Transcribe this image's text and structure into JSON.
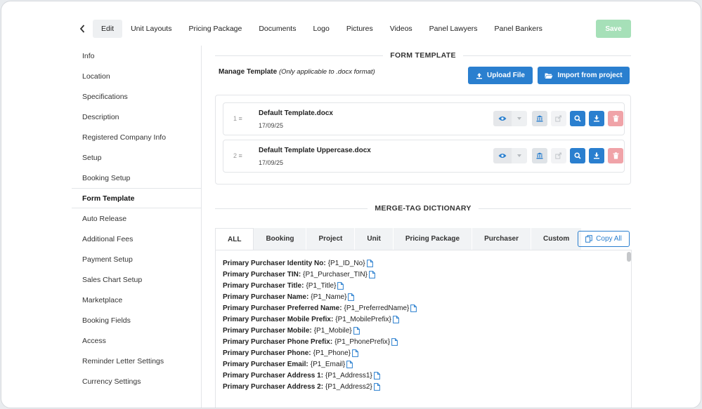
{
  "nav": {
    "tabs": [
      "Edit",
      "Unit Layouts",
      "Pricing Package",
      "Documents",
      "Logo",
      "Pictures",
      "Videos",
      "Panel Lawyers",
      "Panel Bankers"
    ],
    "active_tab": "Edit",
    "save_label": "Save"
  },
  "sidebar": {
    "items": [
      "Info",
      "Location",
      "Specifications",
      "Description",
      "Registered Company Info",
      "Setup",
      "Booking Setup",
      "Form Template",
      "Auto Release",
      "Additional Fees",
      "Payment Setup",
      "Sales Chart Setup",
      "Marketplace",
      "Booking Fields",
      "Access",
      "Reminder Letter Settings",
      "Currency Settings"
    ],
    "active": "Form Template"
  },
  "form_template": {
    "heading": "FORM TEMPLATE",
    "manage_label": "Manage Template",
    "manage_note": "(Only applicable to .docx format)",
    "upload_label": "Upload File",
    "import_label": "Import from project",
    "templates": [
      {
        "num": "1",
        "name": "Default Template.docx",
        "date": "17/09/25"
      },
      {
        "num": "2",
        "name": "Default Template Uppercase.docx",
        "date": "17/09/25"
      }
    ]
  },
  "merge": {
    "heading": "MERGE-TAG DICTIONARY",
    "tabs": [
      "ALL",
      "Booking",
      "Project",
      "Unit",
      "Pricing Package",
      "Purchaser",
      "Custom"
    ],
    "active_tab": "ALL",
    "copy_all_label": "Copy All",
    "tags": [
      {
        "label": "Primary Purchaser Identity No:",
        "tag": "{P1_ID_No}"
      },
      {
        "label": "Primary Purchaser TIN:",
        "tag": "{P1_Purchaser_TIN}"
      },
      {
        "label": "Primary Purchaser Title:",
        "tag": "{P1_Title}"
      },
      {
        "label": "Primary Purchaser Name:",
        "tag": "{P1_Name}"
      },
      {
        "label": "Primary Purchaser Preferred Name:",
        "tag": "{P1_PreferredName}"
      },
      {
        "label": "Primary Purchaser Mobile Prefix:",
        "tag": "{P1_MobilePrefix}"
      },
      {
        "label": "Primary Purchaser Mobile:",
        "tag": "{P1_Mobile}"
      },
      {
        "label": "Primary Purchaser Phone Prefix:",
        "tag": "{P1_PhonePrefix}"
      },
      {
        "label": "Primary Purchaser Phone:",
        "tag": "{P1_Phone}"
      },
      {
        "label": "Primary Purchaser Email:",
        "tag": "{P1_Email}"
      },
      {
        "label": "Primary Purchaser Address 1:",
        "tag": "{P1_Address1}"
      },
      {
        "label": "Primary Purchaser Address 2:",
        "tag": "{P1_Address2}"
      }
    ]
  },
  "colors": {
    "primary": "#2a7fcf",
    "save_disabled": "#a6e0b8",
    "delete_disabled": "#f0a3a8"
  }
}
